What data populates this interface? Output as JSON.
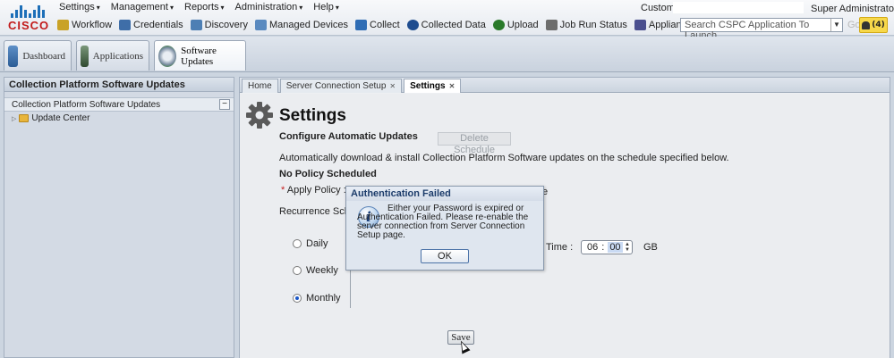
{
  "brand": {
    "logo_text": "CISCO"
  },
  "menu": {
    "items": [
      "Settings",
      "Management",
      "Reports",
      "Administration",
      "Help"
    ],
    "caret": "▾"
  },
  "toolbar": {
    "items": [
      {
        "label": "Workflow",
        "icon": "workflow-icon",
        "color": "#c9a227"
      },
      {
        "label": "Credentials",
        "icon": "credentials-icon",
        "color": "#3f6ea8"
      },
      {
        "label": "Discovery",
        "icon": "discovery-icon",
        "color": "#4d7fb4"
      },
      {
        "label": "Managed Devices",
        "icon": "managed-devices-icon",
        "color": "#5a8ac0"
      },
      {
        "label": "Collect",
        "icon": "collect-icon",
        "color": "#2f6db5"
      },
      {
        "label": "Collected Data",
        "icon": "collected-data-icon",
        "color": "#1e4c8f"
      },
      {
        "label": "Upload",
        "icon": "upload-icon",
        "color": "#2a7a2a"
      },
      {
        "label": "Job Run Status",
        "icon": "job-run-status-icon",
        "color": "#6d6d6d"
      },
      {
        "label": "Appliance Config",
        "icon": "appliance-config-icon",
        "color": "#4a4f8f"
      }
    ]
  },
  "header": {
    "customer_label": "Customer:",
    "customer_value": "",
    "user": "Super Administrator ▾",
    "search_placeholder": "Search CSPC Application To Launch",
    "go_label": "Go",
    "alert_count": "(4)"
  },
  "apps": [
    {
      "label": "Dashboard",
      "icon": "dashboard-icon",
      "color": "#3b6ea5"
    },
    {
      "label": "Applications",
      "icon": "applications-icon",
      "color": "#4d6b4d"
    },
    {
      "label": "Software Updates",
      "icon": "software-updates-icon",
      "color": "#6b7c91"
    }
  ],
  "left_panel": {
    "title": "Collection Platform Software Updates",
    "section": "Collection Platform Software Updates",
    "collapse": "−",
    "tree": [
      {
        "label": "Update Center"
      }
    ]
  },
  "tabs": [
    {
      "label": "Home",
      "closable": false
    },
    {
      "label": "Server Connection Setup",
      "closable": true
    },
    {
      "label": "Settings",
      "closable": true,
      "active": true
    }
  ],
  "settings": {
    "title": "Settings",
    "configure_title": "Configure Automatic Updates",
    "delete_schedule": "Delete Schedule",
    "description": "Automatically download & install Collection Platform Software updates on the schedule specified below.",
    "no_policy": "No Policy Scheduled",
    "apply_policy_label": "Apply Policy :",
    "apply_policy_req": "*",
    "apply_fragment": "e",
    "recurrence_label": "Recurrence Sche",
    "recurrence_options": [
      {
        "label": "Daily",
        "checked": false
      },
      {
        "label": "Weekly",
        "checked": false
      },
      {
        "label": "Monthly",
        "checked": true
      }
    ],
    "time_label": "Time :",
    "time_hours": "06",
    "time_sep": ":",
    "time_minutes": "00",
    "size_unit": "GB",
    "save": "Save"
  },
  "dialog": {
    "title": "Authentication Failed",
    "icon": "info-icon",
    "message": "Either your Password is expired or Authentication Failed. Please re-enable the server connection from Server Connection Setup page.",
    "ok": "OK"
  }
}
